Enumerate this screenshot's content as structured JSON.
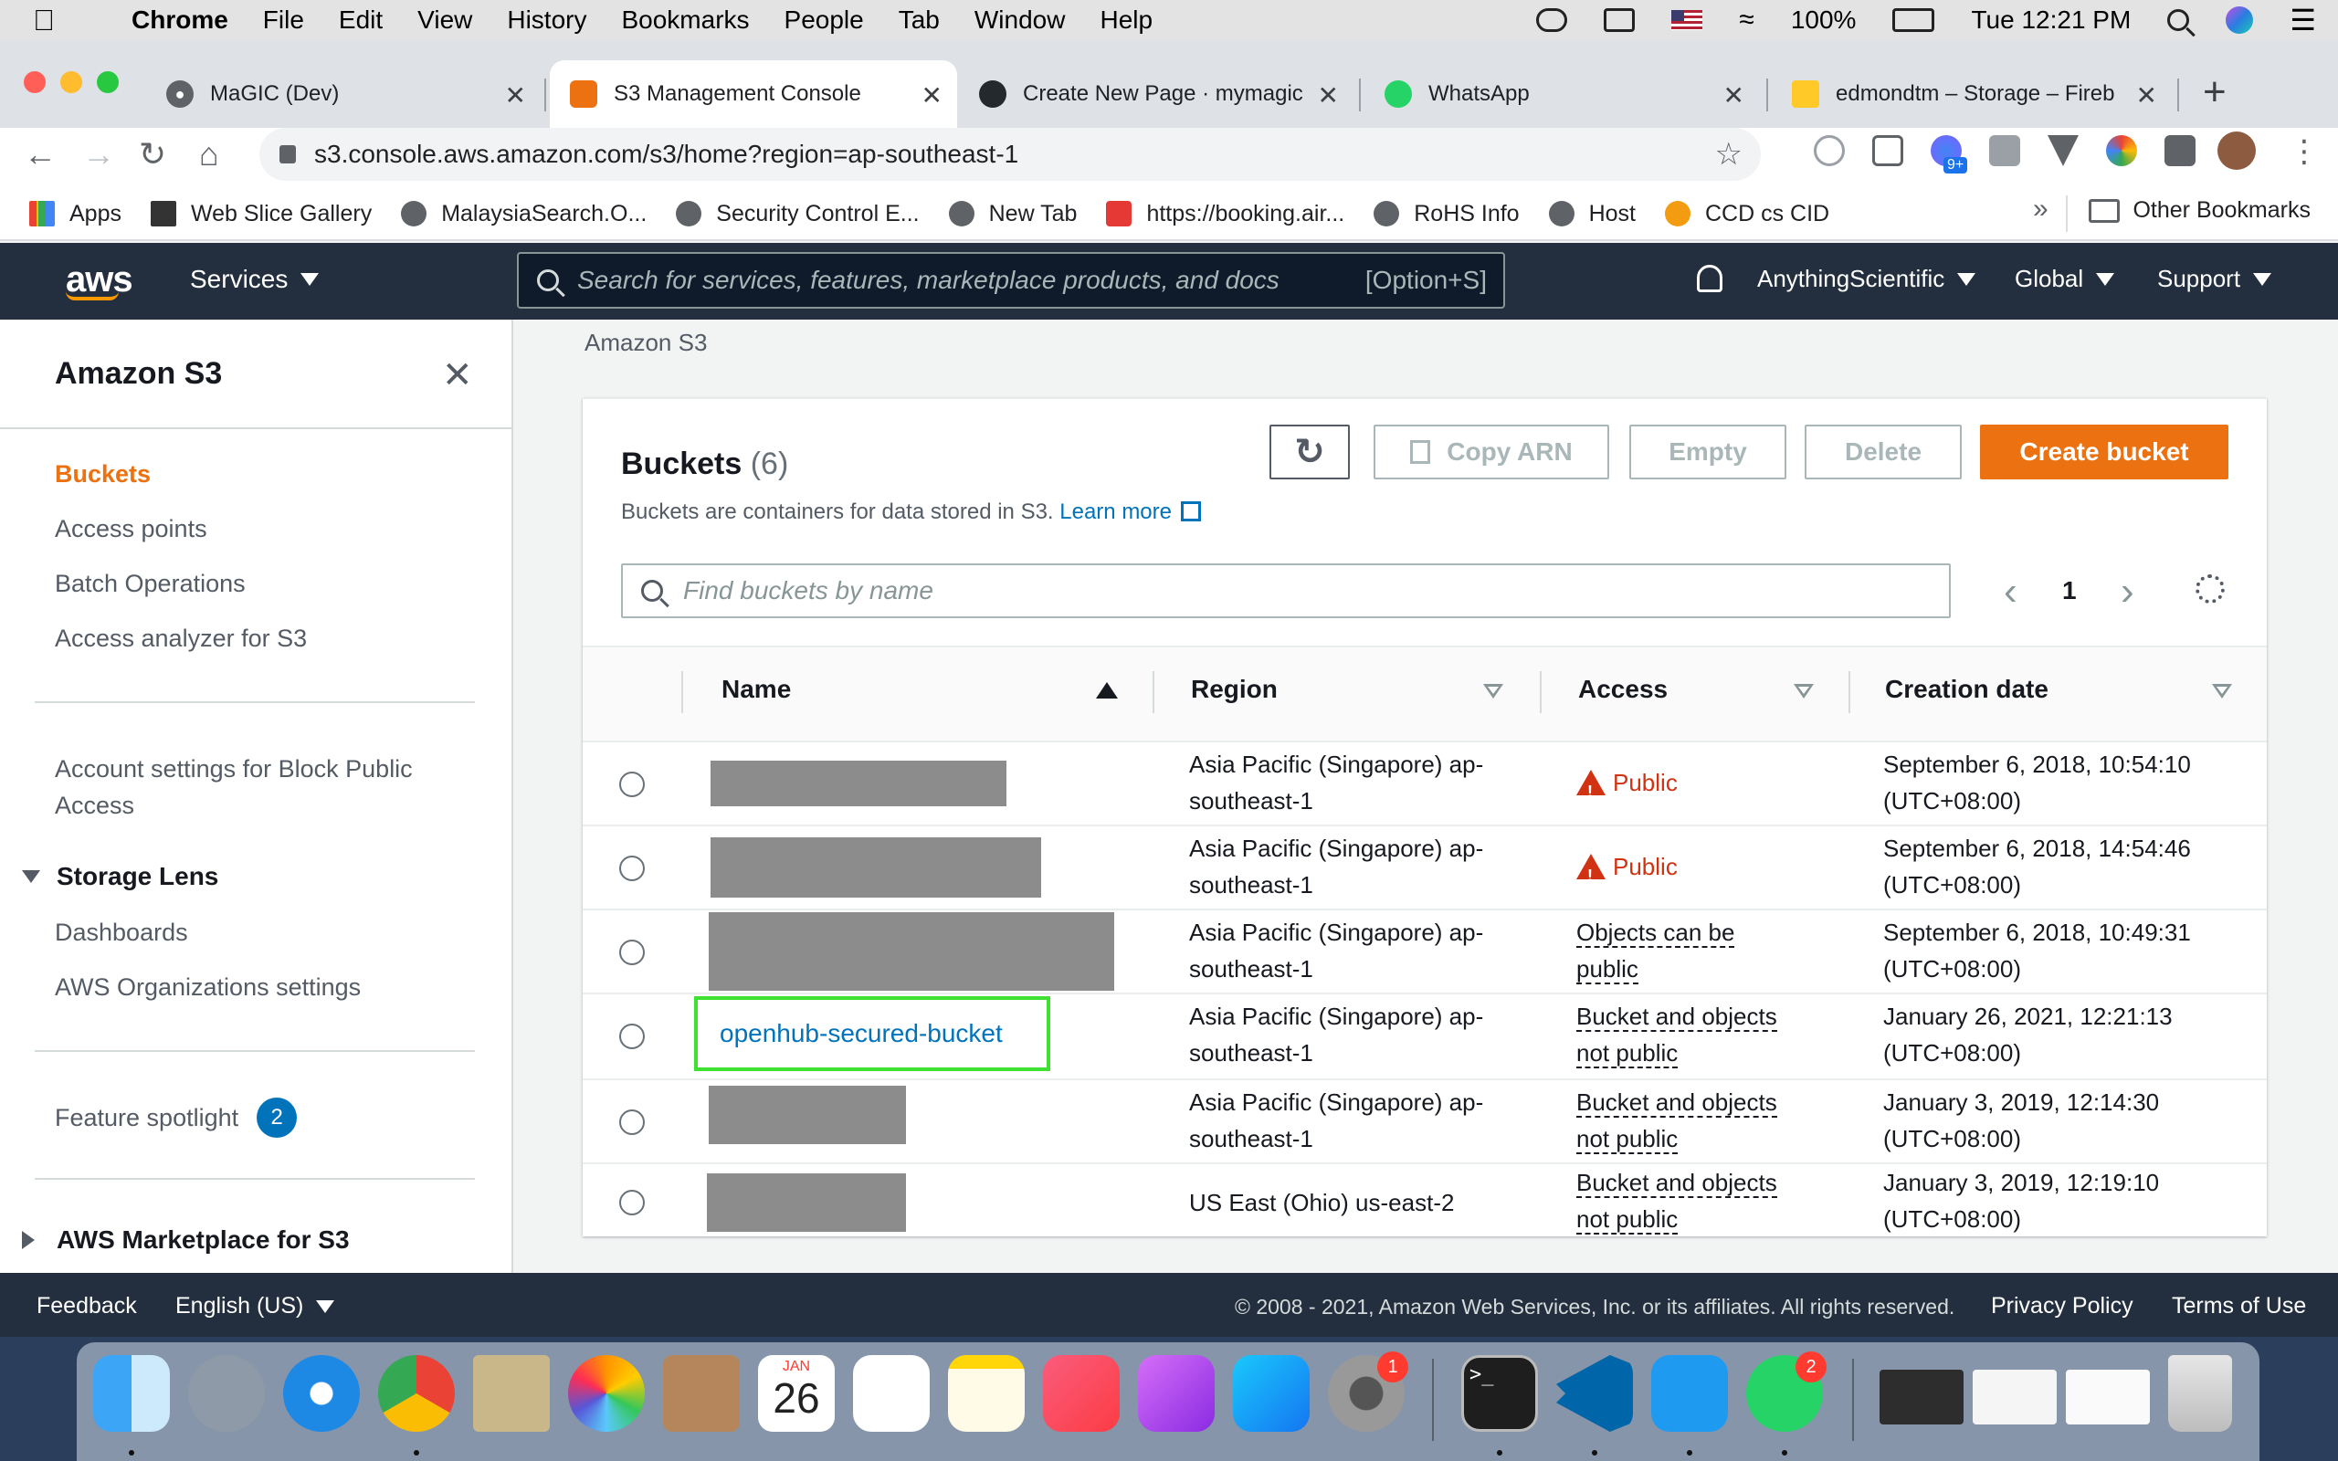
{
  "macos_menubar": {
    "app": "Chrome",
    "menus": [
      "File",
      "Edit",
      "View",
      "History",
      "Bookmarks",
      "People",
      "Tab",
      "Window",
      "Help"
    ],
    "battery": "100%",
    "clock": "Tue 12:21 PM"
  },
  "browser": {
    "tabs": [
      {
        "title": "MaGIC (Dev)",
        "active": false
      },
      {
        "title": "S3 Management Console",
        "active": true
      },
      {
        "title": "Create New Page · mymagic",
        "active": false
      },
      {
        "title": "WhatsApp",
        "active": false
      },
      {
        "title": "edmondtm – Storage – Fireb",
        "active": false
      }
    ],
    "url": "s3.console.aws.amazon.com/s3/home?region=ap-southeast-1",
    "extension_badge": "9+",
    "bookmarks": [
      "Apps",
      "Web Slice Gallery",
      "MalaysiaSearch.O...",
      "Security Control E...",
      "New Tab",
      "https://booking.air...",
      "RoHS Info",
      "Host",
      "CCD cs CID"
    ],
    "bookmarks_more": "»",
    "other_bookmarks": "Other Bookmarks"
  },
  "aws_header": {
    "logo": "aws",
    "services": "Services",
    "search_placeholder": "Search for services, features, marketplace products, and docs",
    "search_shortcut": "[Option+S]",
    "account": "AnythingScientific",
    "region": "Global",
    "support": "Support"
  },
  "sidebar": {
    "title": "Amazon S3",
    "items": [
      "Buckets",
      "Access points",
      "Batch Operations",
      "Access analyzer for S3"
    ],
    "block_public_line1": "Account settings for Block Public",
    "block_public_line2": "Access",
    "storage_lens": "Storage Lens",
    "storage_lens_items": [
      "Dashboards",
      "AWS Organizations settings"
    ],
    "feature_spotlight": "Feature spotlight",
    "feature_spotlight_count": "2",
    "marketplace": "AWS Marketplace for S3"
  },
  "main": {
    "breadcrumb": "Amazon S3",
    "title": "Buckets",
    "count": "(6)",
    "description": "Buckets are containers for data stored in S3.",
    "learn_more": "Learn more",
    "buttons": {
      "copy_arn": "Copy ARN",
      "empty": "Empty",
      "delete": "Delete",
      "create": "Create bucket"
    },
    "search_placeholder": "Find buckets by name",
    "page": "1",
    "columns": [
      "Name",
      "Region",
      "Access",
      "Creation date"
    ],
    "rows": [
      {
        "name": "",
        "region_1": "Asia Pacific (Singapore) ap-",
        "region_2": "southeast-1",
        "access_1": "Public",
        "access_2": "",
        "date_1": "September 6, 2018, 10:54:10",
        "date_2": "(UTC+08:00)"
      },
      {
        "name": "",
        "region_1": "Asia Pacific (Singapore) ap-",
        "region_2": "southeast-1",
        "access_1": "Public",
        "access_2": "",
        "date_1": "September 6, 2018, 14:54:46",
        "date_2": "(UTC+08:00)"
      },
      {
        "name": "",
        "region_1": "Asia Pacific (Singapore) ap-",
        "region_2": "southeast-1",
        "access_1": "Objects can be",
        "access_2": "public",
        "date_1": "September 6, 2018, 10:49:31",
        "date_2": "(UTC+08:00)"
      },
      {
        "name": "openhub-secured-bucket",
        "region_1": "Asia Pacific (Singapore) ap-",
        "region_2": "southeast-1",
        "access_1": "Bucket and objects",
        "access_2": "not public",
        "date_1": "January 26, 2021, 12:21:13",
        "date_2": "(UTC+08:00)"
      },
      {
        "name": "",
        "region_1": "Asia Pacific (Singapore) ap-",
        "region_2": "southeast-1",
        "access_1": "Bucket and objects",
        "access_2": "not public",
        "date_1": "January 3, 2019, 12:14:30",
        "date_2": "(UTC+08:00)"
      },
      {
        "name": "",
        "region_1": "US East (Ohio) us-east-2",
        "region_2": "",
        "access_1": "Bucket and objects",
        "access_2": "not public",
        "date_1": "January 3, 2019, 12:19:10",
        "date_2": "(UTC+08:00)"
      }
    ]
  },
  "footer": {
    "feedback": "Feedback",
    "language": "English (US)",
    "copyright": "© 2008 - 2021, Amazon Web Services, Inc. or its affiliates. All rights reserved.",
    "privacy": "Privacy Policy",
    "terms": "Terms of Use"
  },
  "dock": {
    "calendar_month": "JAN",
    "calendar_day": "26",
    "badge_system_prefs": "1",
    "badge_whatsapp": "2",
    "terminal_prompt": ">_"
  },
  "colors": {
    "aws_orange": "#ec7211",
    "aws_navy": "#232f3e",
    "link_blue": "#0073bb",
    "public_red": "#d13212",
    "highlight_green": "#3ee131"
  }
}
